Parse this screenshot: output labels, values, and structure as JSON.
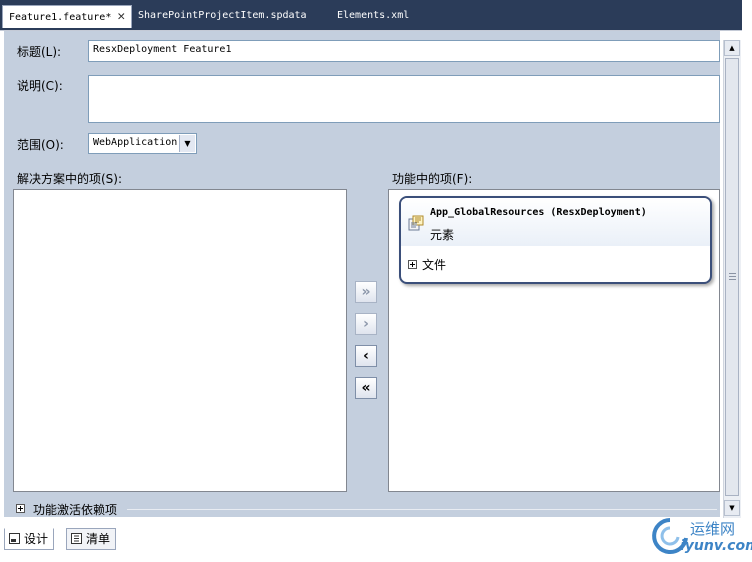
{
  "tabs": [
    {
      "label": "Feature1.feature*",
      "active": true,
      "closable": true
    },
    {
      "label": "SharePointProjectItem.spdata",
      "active": false
    },
    {
      "label": "Elements.xml",
      "active": false
    }
  ],
  "form": {
    "title_label": "标题(L):",
    "title_value": "ResxDeployment Feature1",
    "description_label": "说明(C):",
    "description_value": "",
    "scope_label": "范围(O):",
    "scope_value": "WebApplication"
  },
  "solution_items": {
    "label": "解决方案中的项(S):",
    "items": []
  },
  "feature_items": {
    "label": "功能中的项(F):",
    "card": {
      "title": "App_GlobalResources (ResxDeployment)",
      "subtitle": "元素",
      "section": "文件"
    }
  },
  "move_buttons": {
    "add_all": "»",
    "add": "›",
    "remove": "‹",
    "remove_all": "«"
  },
  "dependencies": {
    "label": "功能激活依赖项"
  },
  "view_tabs": {
    "design": "设计",
    "manifest": "清单"
  },
  "watermark": {
    "line1": "运维网",
    "line2": "iyunv.com"
  },
  "colors": {
    "tabstrip": "#2b3c59",
    "designer_bg": "#c4cfde",
    "card_border": "#3b4f7a",
    "watermark": "#3d84c6"
  }
}
